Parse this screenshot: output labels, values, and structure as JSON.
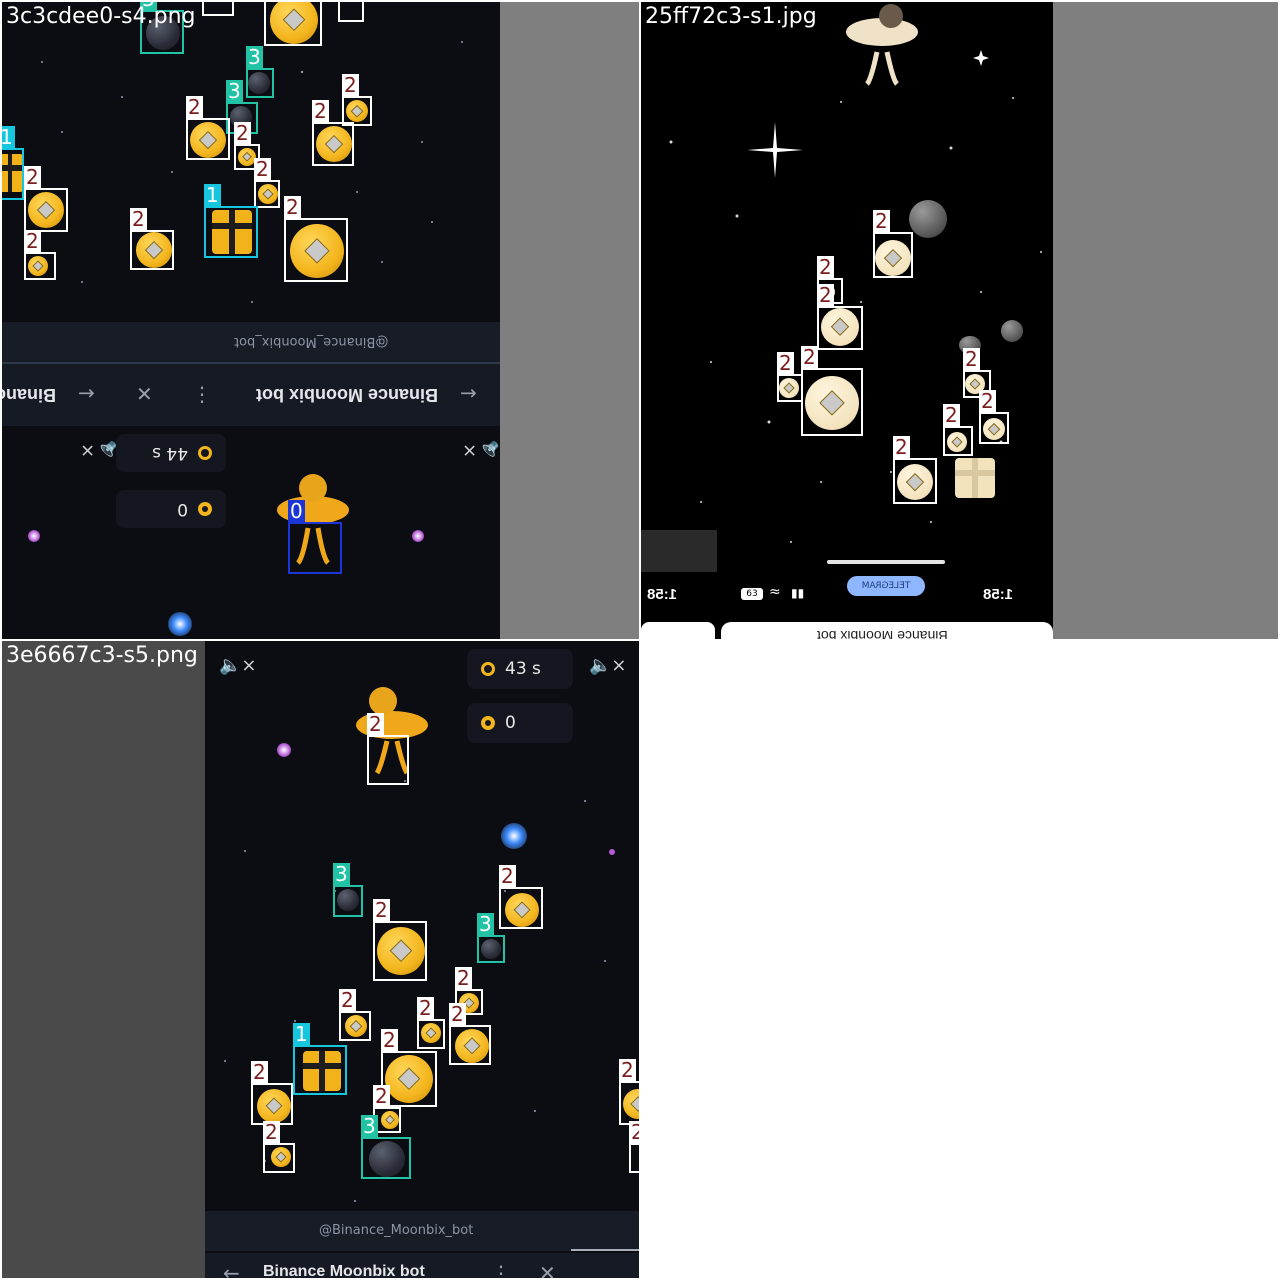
{
  "tiles": [
    {
      "file_label": "3c3cdee0-s4.png",
      "bot_handle": "@Binance_Moonbix_bot",
      "nav_title": "Binance Moonbix bot",
      "nav_partial": "Binanc",
      "timer_text": "44 s",
      "score_text": "0",
      "boxes": [
        {
          "cls": "3",
          "label": "3"
        },
        {
          "cls": "2",
          "label": "2"
        },
        {
          "cls": "2",
          "label": "2"
        },
        {
          "cls": "2",
          "label": "2"
        },
        {
          "cls": "3",
          "label": "3"
        },
        {
          "cls": "3",
          "label": "3"
        },
        {
          "cls": "2",
          "label": "2"
        },
        {
          "cls": "2",
          "label": "2"
        },
        {
          "cls": "2",
          "label": "2"
        },
        {
          "cls": "1",
          "label": "1"
        },
        {
          "cls": "2",
          "label": "2"
        },
        {
          "cls": "2",
          "label": "2"
        },
        {
          "cls": "1",
          "label": "1"
        },
        {
          "cls": "2",
          "label": "2"
        },
        {
          "cls": "2",
          "label": "2"
        },
        {
          "cls": "2",
          "label": "2"
        },
        {
          "cls": "2",
          "label": "2"
        },
        {
          "cls": "0",
          "label": "0"
        }
      ]
    },
    {
      "file_label": "25ff72c3-s1.jpg",
      "status_time_left": "1:58",
      "status_time_right": "1:58",
      "telegram_pill": "TELEGRAM",
      "battery": "63",
      "bottom_title": "Binance Moonbix bot",
      "boxes": [
        {
          "cls": "2",
          "label": "2"
        },
        {
          "cls": "2",
          "label": "2"
        },
        {
          "cls": "2",
          "label": "2"
        },
        {
          "cls": "2",
          "label": "2"
        },
        {
          "cls": "2",
          "label": "2"
        },
        {
          "cls": "2",
          "label": "2"
        },
        {
          "cls": "2",
          "label": "2"
        },
        {
          "cls": "2",
          "label": "2"
        },
        {
          "cls": "2",
          "label": "2"
        },
        {
          "cls": "2",
          "label": "2"
        }
      ]
    },
    {
      "file_label": "3e6667c3-s5.png",
      "timer_text": "43 s",
      "score_text": "0",
      "bot_handle": "@Binance_Moonbix_bot",
      "nav_title": "Binance Moonbix bot",
      "boxes": [
        {
          "cls": "2",
          "label": "2"
        },
        {
          "cls": "3",
          "label": "3"
        },
        {
          "cls": "2",
          "label": "2"
        },
        {
          "cls": "2",
          "label": "2"
        },
        {
          "cls": "3",
          "label": "3"
        },
        {
          "cls": "2",
          "label": "2"
        },
        {
          "cls": "2",
          "label": "2"
        },
        {
          "cls": "2",
          "label": "2"
        },
        {
          "cls": "2",
          "label": "2"
        },
        {
          "cls": "1",
          "label": "1"
        },
        {
          "cls": "2",
          "label": "2"
        },
        {
          "cls": "2",
          "label": "2"
        },
        {
          "cls": "2",
          "label": "2"
        },
        {
          "cls": "2",
          "label": "2"
        },
        {
          "cls": "3",
          "label": "3"
        },
        {
          "cls": "2",
          "label": "2"
        },
        {
          "cls": "2",
          "label": "2"
        }
      ]
    }
  ],
  "colors": {
    "class_0": "#1c35d6",
    "class_1": "#16c6df",
    "class_2": "#ffffff",
    "class_3": "#22c3a5",
    "game_background": "#0b0d12",
    "coin_gold": "#f3b51d"
  },
  "icons": [
    "mute-icon",
    "timer-icon",
    "coin-icon",
    "arrow-icon",
    "close-icon",
    "more-icon",
    "wifi-icon",
    "battery-icon",
    "telegram-icon"
  ]
}
